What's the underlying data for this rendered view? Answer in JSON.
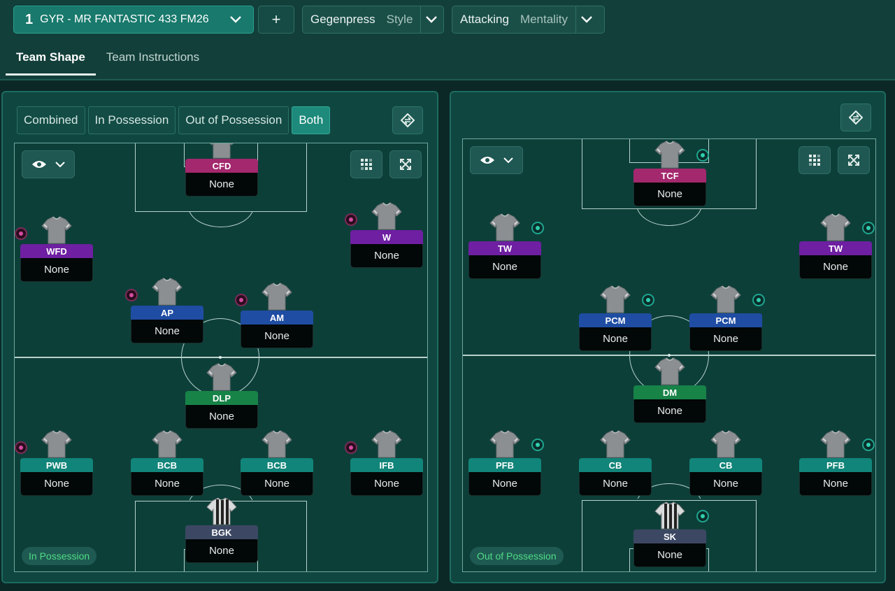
{
  "header": {
    "tactic_number": "1",
    "tactic_name": "GYR - MR FANTASTIC 433 FM26",
    "add_label": "+",
    "style": {
      "value": "Gegenpress",
      "label": "Style"
    },
    "mentality": {
      "value": "Attacking",
      "label": "Mentality"
    }
  },
  "tabs": [
    {
      "label": "Team Shape",
      "active": true
    },
    {
      "label": "Team Instructions",
      "active": false
    }
  ],
  "view_modes": [
    {
      "label": "Combined",
      "active": false
    },
    {
      "label": "In Possession",
      "active": false
    },
    {
      "label": "Out of Possession",
      "active": false
    },
    {
      "label": "Both",
      "active": true
    }
  ],
  "left_pitch": {
    "badge": "In Possession",
    "players": [
      {
        "role": "CFD",
        "name": "None",
        "color": "#a3286d"
      },
      {
        "role": "WFD",
        "name": "None",
        "color": "#6e1fa2"
      },
      {
        "role": "W",
        "name": "None",
        "color": "#6e1fa2"
      },
      {
        "role": "AP",
        "name": "None",
        "color": "#1f4da3"
      },
      {
        "role": "AM",
        "name": "None",
        "color": "#1f4da3"
      },
      {
        "role": "DLP",
        "name": "None",
        "color": "#178347"
      },
      {
        "role": "PWB",
        "name": "None",
        "color": "#12857a"
      },
      {
        "role": "BCB",
        "name": "None",
        "color": "#12857a"
      },
      {
        "role": "BCB",
        "name": "None",
        "color": "#12857a"
      },
      {
        "role": "IFB",
        "name": "None",
        "color": "#12857a"
      },
      {
        "role": "BGK",
        "name": "None",
        "color": "#3c4863"
      }
    ]
  },
  "right_pitch": {
    "badge": "Out of Possession",
    "players": [
      {
        "role": "TCF",
        "name": "None",
        "color": "#a3286d"
      },
      {
        "role": "TW",
        "name": "None",
        "color": "#6e1fa2"
      },
      {
        "role": "TW",
        "name": "None",
        "color": "#6e1fa2"
      },
      {
        "role": "PCM",
        "name": "None",
        "color": "#1f4da3"
      },
      {
        "role": "PCM",
        "name": "None",
        "color": "#1f4da3"
      },
      {
        "role": "DM",
        "name": "None",
        "color": "#178347"
      },
      {
        "role": "PFB",
        "name": "None",
        "color": "#12857a"
      },
      {
        "role": "CB",
        "name": "None",
        "color": "#12857a"
      },
      {
        "role": "CB",
        "name": "None",
        "color": "#12857a"
      },
      {
        "role": "PFB",
        "name": "None",
        "color": "#12857a"
      },
      {
        "role": "SK",
        "name": "None",
        "color": "#3c4863"
      }
    ]
  },
  "icons": {
    "tactic_dropdown": "chevron-down-icon",
    "visibility": "eye-icon",
    "grid_toggle": "grid-icon",
    "expand": "expand-icon",
    "swap": "swap-icon"
  }
}
